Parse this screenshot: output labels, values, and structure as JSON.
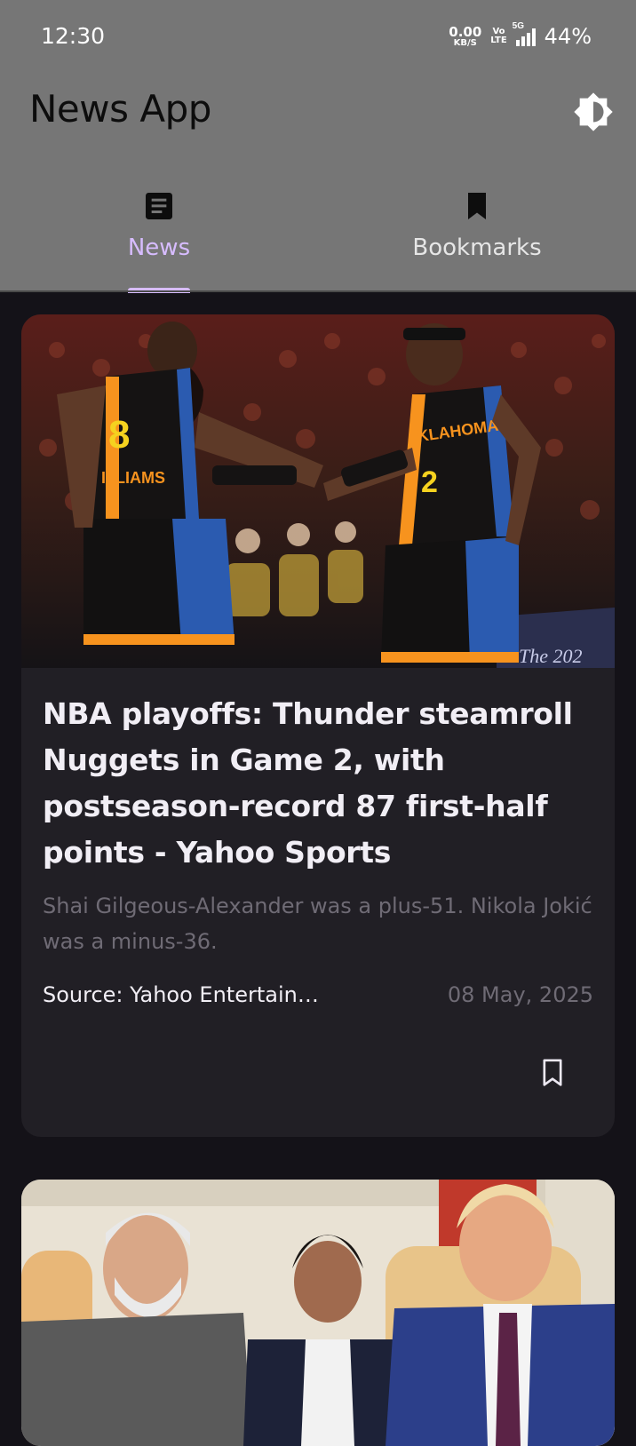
{
  "status_bar": {
    "time": "12:30",
    "net_speed_value": "0.00",
    "net_speed_unit": "KB/S",
    "volte_top": "Vo",
    "volte_bottom": "LTE",
    "network": "5G",
    "battery": "44%"
  },
  "app_bar": {
    "title": "News App",
    "theme_toggle_icon": "brightness-contrast-icon"
  },
  "tabs": [
    {
      "label": "News",
      "icon": "article-icon",
      "selected": true
    },
    {
      "label": "Bookmarks",
      "icon": "bookmark-filled-icon",
      "selected": false
    }
  ],
  "articles": [
    {
      "title": "NBA playoffs: Thunder steamroll Nuggets in Game 2, with postseason-record 87 first-half points - Yahoo Sports",
      "description": "Shai Gilgeous-Alexander was a plus-51. Nikola Jokić was a minus-36.",
      "source": "Source: Yahoo Entertainment",
      "date": "08 May, 2025",
      "bookmark_icon": "bookmark-outline-icon",
      "image_text": {
        "jersey_left_number": "8",
        "jersey_left_name": "ILLIAMS",
        "jersey_right_number": "2",
        "jersey_right_name": "KLAHOMA",
        "banner": "The 202"
      }
    },
    {
      "title": "",
      "image_text": {}
    }
  ],
  "colors": {
    "app_bar": "#767676",
    "background": "#141218",
    "card": "#211f25",
    "accent": "#d7bcff"
  }
}
